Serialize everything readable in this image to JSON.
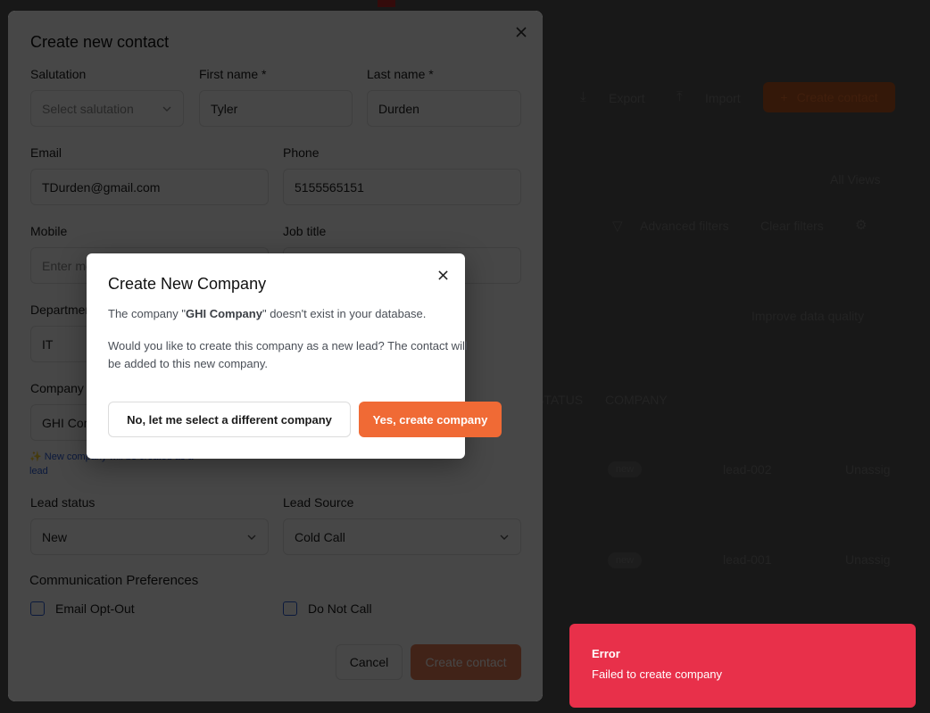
{
  "background": {
    "toolbar": {
      "export_label": "Export",
      "import_label": "Import",
      "create_contact_label": "Create contact"
    },
    "views_label": "All Views",
    "filters": {
      "advanced_label": "Advanced filters",
      "clear_label": "Clear filters"
    },
    "improve_label": "Improve data quality",
    "table": {
      "columns": [
        "STATUS",
        "COMPANY"
      ],
      "rows": [
        {
          "status": "new",
          "company": "lead-002",
          "owner": "Unassig"
        },
        {
          "status": "new",
          "company": "lead-001",
          "owner": "Unassig"
        }
      ]
    }
  },
  "contact_modal": {
    "title": "Create new contact",
    "salutation": {
      "label": "Salutation",
      "placeholder": "Select salutation"
    },
    "first_name": {
      "label": "First name *",
      "value": "Tyler"
    },
    "last_name": {
      "label": "Last name *",
      "value": "Durden"
    },
    "email": {
      "label": "Email",
      "value": "TDurden@gmail.com"
    },
    "phone": {
      "label": "Phone",
      "value": "5155565151"
    },
    "mobile": {
      "label": "Mobile",
      "placeholder": "Enter mobile"
    },
    "job_title": {
      "label": "Job title",
      "value": ""
    },
    "department": {
      "label": "Department",
      "value": "IT"
    },
    "company": {
      "label": "Company",
      "value": "GHI Company",
      "hint": "New company will be created as a lead"
    },
    "lead_status": {
      "label": "Lead status",
      "value": "New"
    },
    "lead_source": {
      "label": "Lead Source",
      "value": "Cold Call"
    },
    "communication": {
      "title": "Communication Preferences",
      "email_opt_out": "Email Opt-Out",
      "do_not_call": "Do Not Call"
    },
    "cancel_label": "Cancel",
    "create_label": "Create contact"
  },
  "company_dialog": {
    "title": "Create New Company",
    "line1_prefix": "The company \"",
    "company_name": "GHI Company",
    "line1_suffix": "\" doesn't exist in your database.",
    "line2": "Would you like to create this company as a new lead? The contact will be added to this new company.",
    "no_label": "No, let me select a different company",
    "yes_label": "Yes, create company"
  },
  "toast": {
    "title": "Error",
    "message": "Failed to create company"
  },
  "colors": {
    "accent": "#f06a35",
    "error": "#e8304a",
    "checkbox_border": "#2a5bd7"
  },
  "icons": [
    "close-icon",
    "chevron-down-icon",
    "download-icon",
    "upload-icon",
    "filter-icon",
    "gear-icon",
    "sparkle-icon"
  ]
}
